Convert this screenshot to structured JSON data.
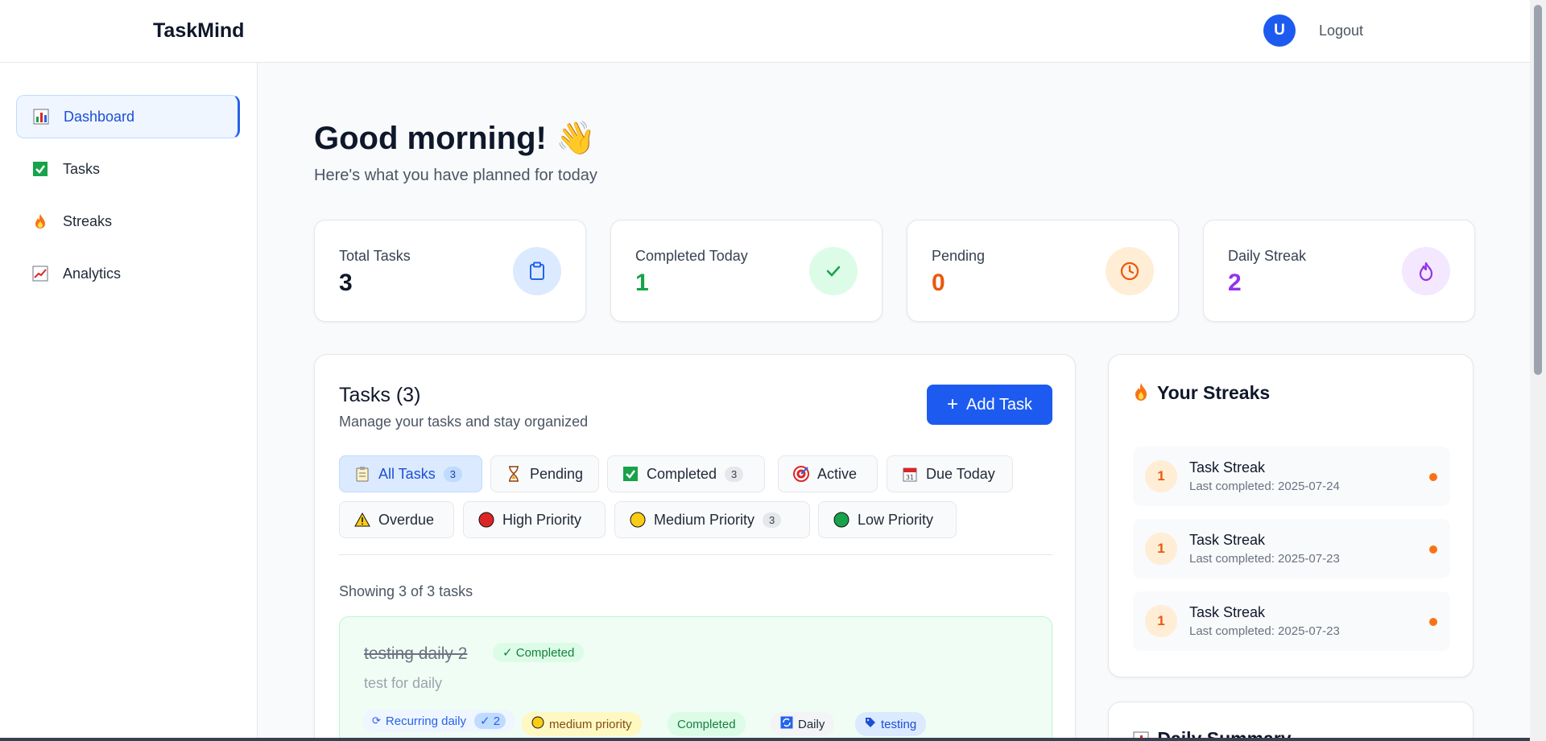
{
  "app": {
    "brand": "TaskMind"
  },
  "header": {
    "avatar_initial": "U",
    "logout_label": "Logout"
  },
  "sidebar": {
    "items": [
      {
        "label": "Dashboard",
        "icon": "bar-chart-icon",
        "active": true
      },
      {
        "label": "Tasks",
        "icon": "check-box-icon",
        "active": false
      },
      {
        "label": "Streaks",
        "icon": "fire-icon",
        "active": false
      },
      {
        "label": "Analytics",
        "icon": "line-chart-icon",
        "active": false
      }
    ]
  },
  "main": {
    "greeting": "Good morning! 👋",
    "subtitle": "Here's what you have planned for today",
    "stats": [
      {
        "label": "Total Tasks",
        "value": "3",
        "color": "#0f172a",
        "icon": "clipboard-icon",
        "icon_bg": "#dbeafe",
        "icon_color": "#2563eb"
      },
      {
        "label": "Completed Today",
        "value": "1",
        "color": "#16a34a",
        "icon": "check-icon",
        "icon_bg": "#dcfce7",
        "icon_color": "#16a34a"
      },
      {
        "label": "Pending",
        "value": "0",
        "color": "#ea580c",
        "icon": "clock-icon",
        "icon_bg": "#ffedd5",
        "icon_color": "#ea580c"
      },
      {
        "label": "Daily Streak",
        "value": "2",
        "color": "#9333ea",
        "icon": "flame-icon",
        "icon_bg": "#f3e8ff",
        "icon_color": "#9333ea"
      }
    ],
    "tasks_panel": {
      "title": "Tasks (3)",
      "subtitle": "Manage your tasks and stay organized",
      "add_button": "Add Task",
      "filters": [
        {
          "label": "All Tasks",
          "count": "3",
          "icon": "clipboard-icon",
          "active": true
        },
        {
          "label": "Pending",
          "count": "",
          "icon": "hourglass-icon",
          "active": false
        },
        {
          "label": "Completed",
          "count": "3",
          "icon": "check-box-icon",
          "active": false
        },
        {
          "label": "Active",
          "count": "",
          "icon": "target-icon",
          "active": false
        },
        {
          "label": "Due Today",
          "count": "",
          "icon": "calendar-icon",
          "active": false
        },
        {
          "label": "Overdue",
          "count": "",
          "icon": "warning-icon",
          "active": false
        },
        {
          "label": "High Priority",
          "count": "",
          "icon": "red-circle-icon",
          "active": false
        },
        {
          "label": "Medium Priority",
          "count": "3",
          "icon": "yellow-circle-icon",
          "active": false
        },
        {
          "label": "Low Priority",
          "count": "",
          "icon": "green-circle-icon",
          "active": false
        }
      ],
      "showing": "Showing 3 of 3 tasks",
      "task": {
        "title": "testing daily 2",
        "status": "Completed",
        "description": "test for daily",
        "recurring": "Recurring daily",
        "recurring_count": "✓ 2",
        "priority": "medium priority",
        "state": "Completed",
        "frequency": "Daily",
        "tag": "testing"
      }
    },
    "streaks_panel": {
      "title": "Your Streaks",
      "items": [
        {
          "count": "1",
          "name": "Task Streak",
          "last": "Last completed: 2025-07-24"
        },
        {
          "count": "1",
          "name": "Task Streak",
          "last": "Last completed: 2025-07-23"
        },
        {
          "count": "1",
          "name": "Task Streak",
          "last": "Last completed: 2025-07-23"
        }
      ]
    },
    "summary_panel": {
      "title": "Daily Summary"
    }
  }
}
